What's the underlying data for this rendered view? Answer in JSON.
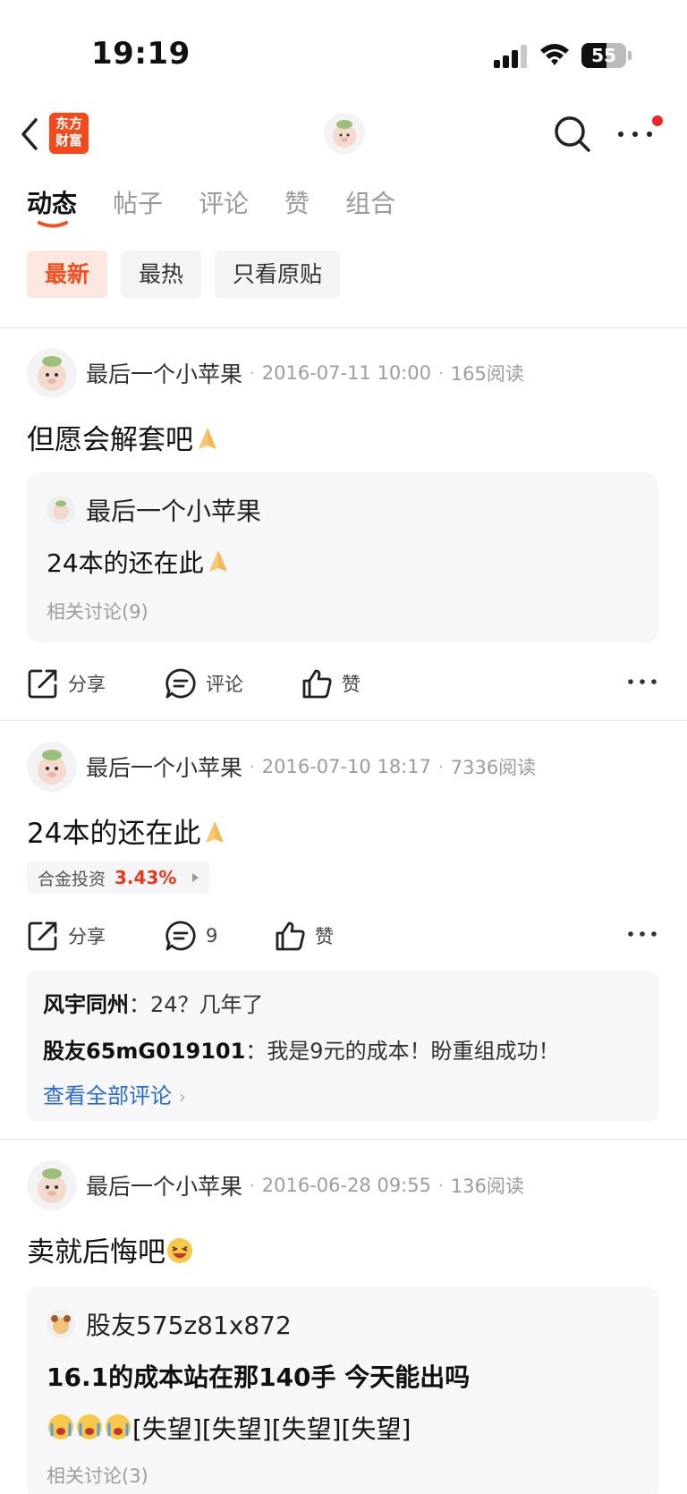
{
  "status_bar": {
    "time": "19:19",
    "battery": "55"
  },
  "nav": {
    "logo_text": "东方财富"
  },
  "tabs": [
    {
      "label": "动态"
    },
    {
      "label": "帖子"
    },
    {
      "label": "评论"
    },
    {
      "label": "赞"
    },
    {
      "label": "组合"
    }
  ],
  "filters": [
    {
      "label": "最新"
    },
    {
      "label": "最热"
    },
    {
      "label": "只看原贴"
    }
  ],
  "posts": [
    {
      "author": "最后一个小苹果",
      "date": "2016-07-11 10:00",
      "reads": "165阅读",
      "text": "但愿会解套吧",
      "quote": {
        "author": "最后一个小苹果",
        "text": "24本的还在此",
        "related": "相关讨论(9)"
      },
      "actions": {
        "share": "分享",
        "comment": "评论",
        "like": "赞"
      }
    },
    {
      "author": "最后一个小苹果",
      "date": "2016-07-10 18:17",
      "reads": "7336阅读",
      "text": "24本的还在此",
      "stock": {
        "name": "合金投资",
        "change": "3.43%"
      },
      "actions": {
        "share": "分享",
        "comment": "9",
        "like": "赞"
      },
      "comments": [
        {
          "user": "风宇同州",
          "text": "24？几年了"
        },
        {
          "user": "股友65mG019101",
          "text": "我是9元的成本！盼重组成功！"
        }
      ],
      "view_all": "查看全部评论"
    },
    {
      "author": "最后一个小苹果",
      "date": "2016-06-28 09:55",
      "reads": "136阅读",
      "text": "卖就后悔吧",
      "quote": {
        "author": "股友575z81x872",
        "title": "16.1的成本站在那140手 今天能出吗",
        "text": "[失望][失望][失望][失望]",
        "related": "相关讨论(3)"
      }
    }
  ],
  "colors": {
    "accent": "#f2501e",
    "price_up": "#e8371b",
    "link": "#2a6ad8"
  }
}
